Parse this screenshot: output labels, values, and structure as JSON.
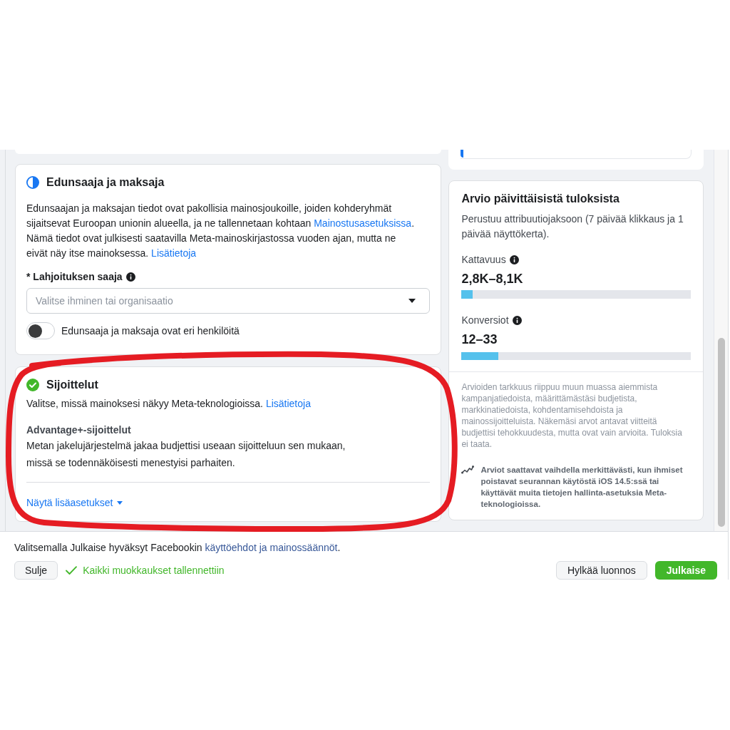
{
  "beneficiary_card": {
    "complete": false,
    "title": "Edunsaaja ja maksaja",
    "description": [
      {
        "kind": "text",
        "text": "Edunsaajan ja maksajan tiedot ovat pakollisia mainosjoukoille, joiden kohderyhmät sijaitsevat Euroopan unionin alueella, ja ne tallennetaan kohtaan "
      },
      {
        "kind": "link",
        "text": "Mainostusasetuksissa"
      },
      {
        "kind": "text",
        "text": ". Nämä tiedot ovat julkisesti saatavilla Meta-mainoskirjastossa vuoden ajan, mutta ne eivät näy itse mainoksessa. "
      },
      {
        "kind": "link",
        "text": "Lisätietoja"
      }
    ],
    "field": {
      "label": "* Lahjoituksen saaja",
      "placeholder": "Valitse ihminen tai organisaatio"
    },
    "toggle": {
      "label": "Edunsaaja ja maksaja ovat eri henkilöitä",
      "on": false
    }
  },
  "placements_card": {
    "complete": true,
    "title": "Sijoittelut",
    "description": [
      {
        "kind": "text",
        "text": "Valitse, missä mainoksesi näkyy Meta-teknologioissa. "
      },
      {
        "kind": "link",
        "text": "Lisätietoja"
      }
    ],
    "option_title": "Advantage+-sijoittelut",
    "option_lines": [
      "Metan jakelujärjestelmä jakaa budjettisi useaan sijoitteluun sen mukaan,",
      "missä se todennäköisesti menestyisi parhaiten."
    ],
    "more_link": "Näytä lisäasetukset"
  },
  "estimate_card": {
    "title": "Arvio päivittäisistä tuloksista",
    "subtitle": "Perustuu attribuutiojaksoon (7 päivää klikkaus ja 1 päivää näyttökerta).",
    "metrics": [
      {
        "label": "Kattavuus",
        "value": "2,8K–8,1K",
        "level": 0.05
      },
      {
        "label": "Konversiot",
        "value": "12–33",
        "level": 0.16
      }
    ],
    "disclaimer": "Arvioiden tarkkuus riippuu muun muassa aiemmista kampanjatiedoista, määrittämästäsi budjetista, markkinatiedoista, kohdentamisehdoista ja mainossijoitteluista. Näkemäsi arvot antavat viitteitä budjettisi tehokkuudesta, mutta ovat vain arvioita. Tuloksia ei taata.",
    "note": "Arviot saattavat vaihdella merkittävästi, kun ihmiset poistavat seurannan käytöstä iOS 14.5:ssä tai käyttävät muita tietojen hallinta-asetuksia Meta-teknologioissa."
  },
  "footer": {
    "terms": [
      {
        "kind": "text",
        "text": "Valitsemalla Julkaise hyväksyt Facebookin "
      },
      {
        "kind": "link",
        "text": "käyttöehdot ja mainossäännöt"
      },
      {
        "kind": "text",
        "text": "."
      }
    ],
    "close_button": "Sulje",
    "saved_status": "Kaikki muokkaukset tallennettiin",
    "discard_button": "Hylkää luonnos",
    "publish_button": "Julkaise"
  }
}
